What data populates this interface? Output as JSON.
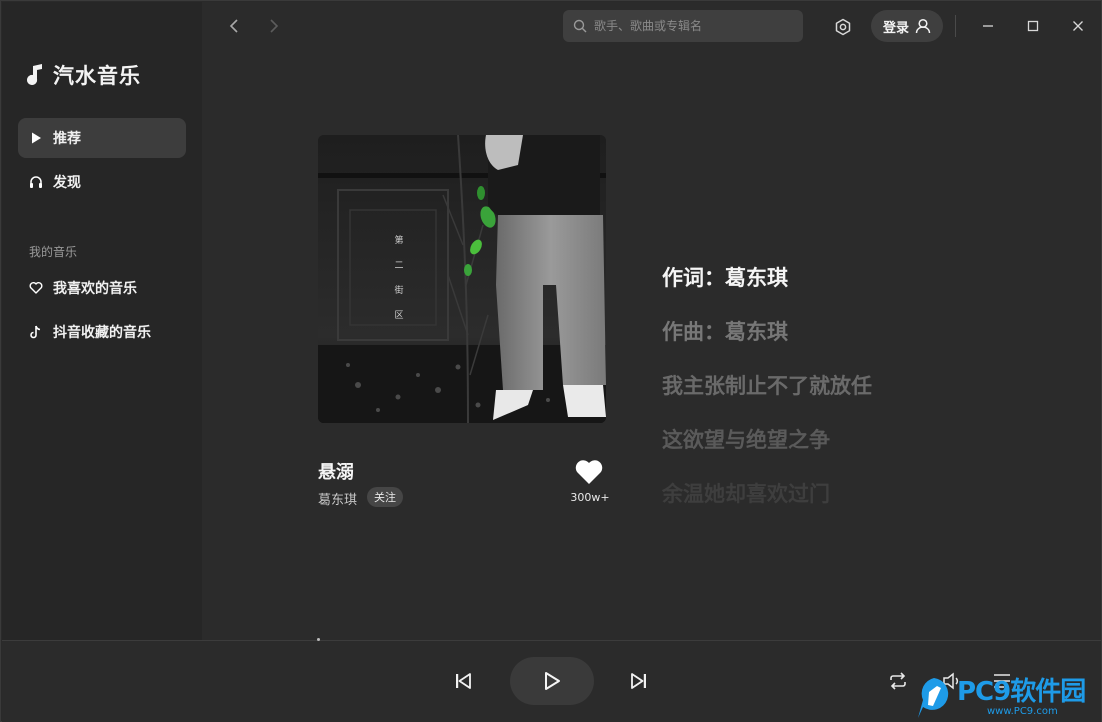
{
  "app": {
    "name": "汽水音乐"
  },
  "sidebar": {
    "items": [
      {
        "label": "推荐",
        "icon": "play-icon",
        "active": true
      },
      {
        "label": "发现",
        "icon": "headphones-icon",
        "active": false
      }
    ],
    "section_title": "我的音乐",
    "my_music": [
      {
        "label": "我喜欢的音乐",
        "icon": "heart-icon"
      },
      {
        "label": "抖音收藏的音乐",
        "icon": "douyin-icon"
      }
    ]
  },
  "topbar": {
    "search_placeholder": "歌手、歌曲或专辑名",
    "login_label": "登录"
  },
  "song": {
    "title": "悬溺",
    "artist": "葛东琪",
    "follow_label": "关注",
    "like_count": "300w+",
    "cover_text": [
      "第",
      "二",
      "街",
      "区"
    ]
  },
  "lyrics": [
    {
      "text": "作词：葛东琪",
      "state": "current"
    },
    {
      "text": "作曲：葛东琪",
      "state": "next"
    },
    {
      "text": "我主张制止不了就放任",
      "state": "next"
    },
    {
      "text": "这欲望与绝望之争",
      "state": "next"
    },
    {
      "text": "余温她却喜欢过门",
      "state": "fading"
    }
  ],
  "colors": {
    "background": "#2b2b2b",
    "sidebar": "#262626",
    "accent_watermark": "#1e9be8"
  },
  "watermark": {
    "main": "PC9软件园",
    "sub": "www.PC9.com"
  }
}
